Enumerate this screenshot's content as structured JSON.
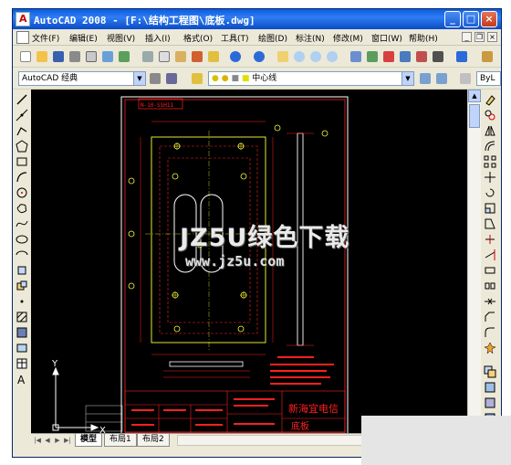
{
  "window": {
    "title": "AutoCAD 2008 - [F:\\结构工程图\\底板.dwg]",
    "minimize_glyph": "_",
    "maximize_glyph": "□",
    "close_glyph": "×"
  },
  "menu": {
    "items": [
      "文件(F)",
      "编辑(E)",
      "视图(V)",
      "插入(I)",
      "格式(O)",
      "工具(T)",
      "绘图(D)",
      "标注(N)",
      "修改(M)",
      "窗口(W)",
      "帮助(H)"
    ],
    "doc_minimize_glyph": "_",
    "doc_restore_glyph": "❐",
    "doc_close_glyph": "×"
  },
  "workspace": {
    "selected": "AutoCAD 经典"
  },
  "layer": {
    "selected": "中心线"
  },
  "style_combo": {
    "value": "ByL"
  },
  "layout_tabs": [
    {
      "label": "模型",
      "active": true
    },
    {
      "label": "布局1",
      "active": false
    },
    {
      "label": "布局2",
      "active": false
    }
  ],
  "ucs": {
    "y_label": "Y",
    "x_label": "X"
  },
  "watermark": {
    "main": "JZ5U绿色下载",
    "url": "www.jz5u.com"
  },
  "drawing": {
    "header_label": "N-10-SSH11",
    "title_block_company": "新海宜电信",
    "title_block_name": "底板"
  },
  "colors": {
    "titlebar": "#0a5cdc",
    "canvas_bg": "#000000",
    "drawing_red": "#ff2020",
    "drawing_yellow": "#ffff33",
    "drawing_white": "#ffffff"
  }
}
